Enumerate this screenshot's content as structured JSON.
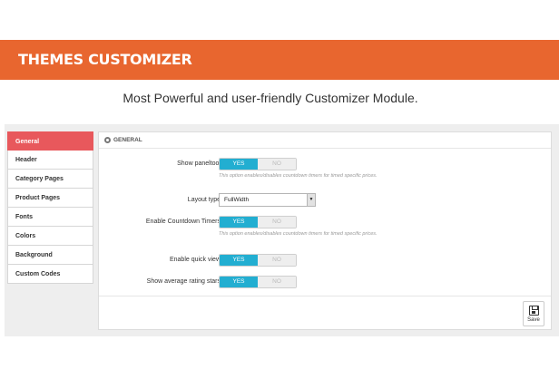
{
  "banner": {
    "title": "THEMES CUSTOMIZER"
  },
  "subtitle": "Most Powerful and user-friendly Customizer Module.",
  "sidebar": {
    "items": [
      {
        "label": "General",
        "active": true
      },
      {
        "label": "Header"
      },
      {
        "label": "Category Pages"
      },
      {
        "label": "Product Pages"
      },
      {
        "label": "Fonts"
      },
      {
        "label": "Colors"
      },
      {
        "label": "Background"
      },
      {
        "label": "Custom Codes"
      }
    ]
  },
  "panel": {
    "heading": "GENERAL",
    "fields": {
      "paneltool": {
        "label": "Show paneltool",
        "yes": "YES",
        "no": "NO",
        "value": "YES",
        "hint": "This option enables/disables countdown timers for timed specific prices."
      },
      "layout": {
        "label": "Layout type",
        "value": "FullWidth"
      },
      "countdown": {
        "label": "Enable Countdown Timers",
        "yes": "YES",
        "no": "NO",
        "value": "YES",
        "hint": "This option enables/disables countdown timers for timed specific prices."
      },
      "quickview": {
        "label": "Enable quick view",
        "yes": "YES",
        "no": "NO",
        "value": "YES"
      },
      "rating": {
        "label": "Show average rating stars",
        "yes": "YES",
        "no": "NO",
        "value": "YES"
      }
    },
    "save_label": "Save"
  },
  "colors": {
    "accent": "#e8662f",
    "active_tab": "#e8585c",
    "toggle_on": "#22aed1"
  },
  "icons": {
    "heading": "cog-icon",
    "save": "floppy-disk-icon",
    "select": "caret-down-icon"
  }
}
